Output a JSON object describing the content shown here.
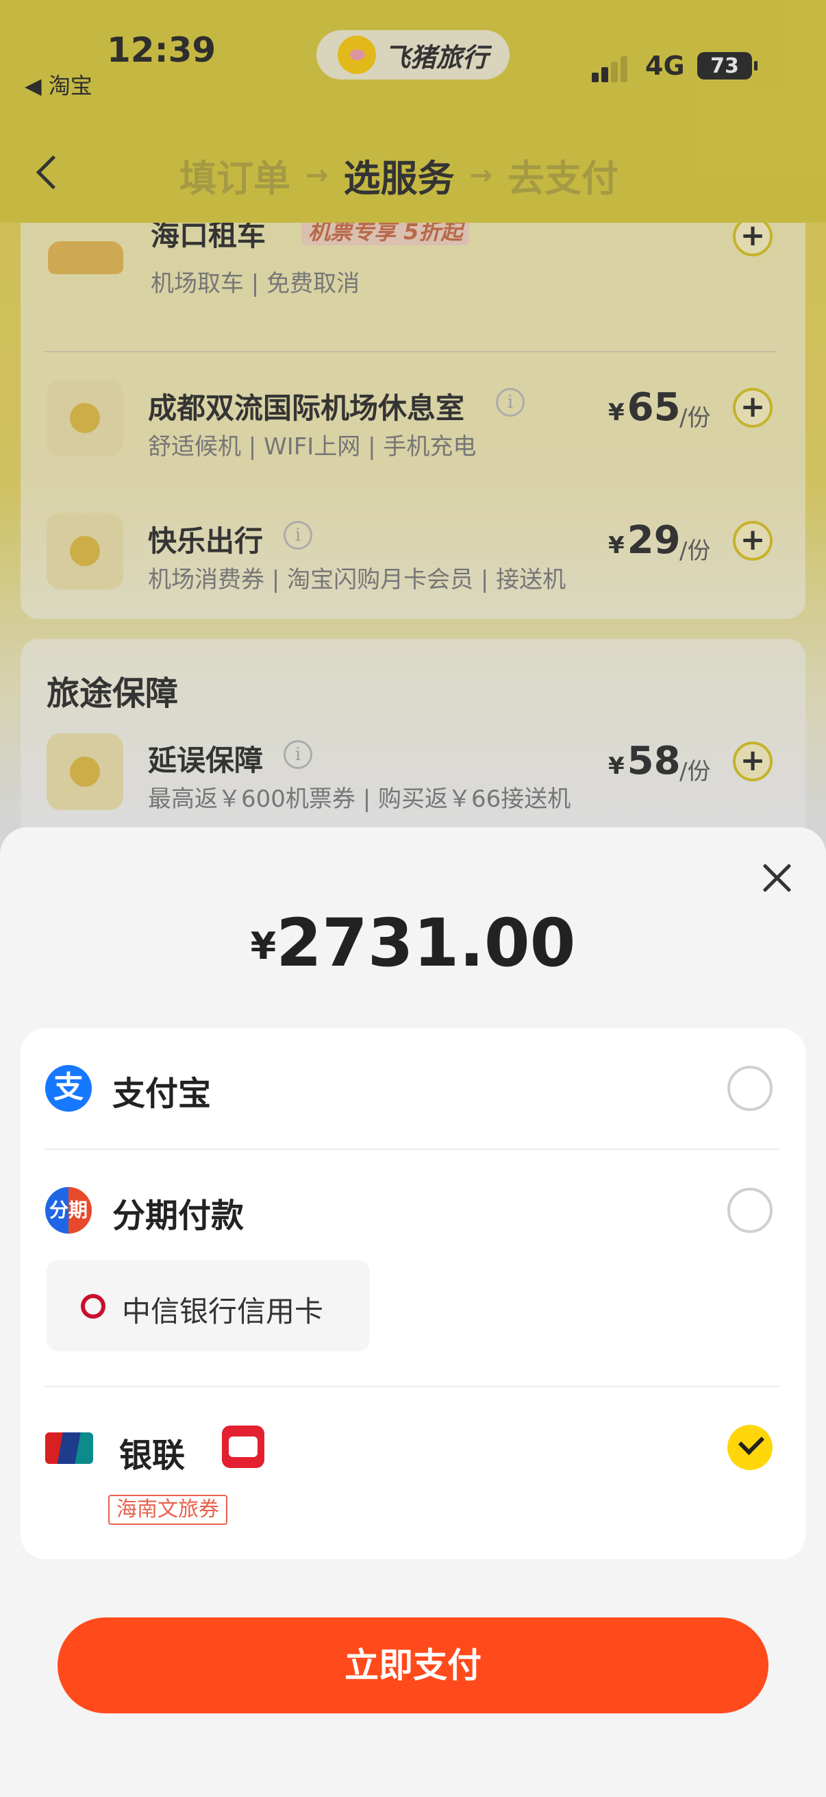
{
  "status_bar": {
    "time": "12:39",
    "back_app": "◀ 淘宝",
    "brand": "飞猪旅行",
    "network": "4G",
    "battery": "73"
  },
  "header": {
    "steps": [
      "填订单",
      "选服务",
      "去支付"
    ],
    "active_step": "选服务",
    "arrow": "→"
  },
  "services": {
    "car_rental": {
      "title": "海口租车",
      "tag": "机票专享 5折起",
      "sub": "机场取车 | 免费取消"
    },
    "lounge": {
      "title": "成都双流国际机场休息室",
      "sub": "舒适候机 | WIFI上网 | 手机充电",
      "price": "65",
      "currency": "¥",
      "unit": "/份"
    },
    "happy_travel": {
      "title": "快乐出行",
      "sub": "机场消费券 | 淘宝闪购月卡会员 | 接送机",
      "price": "29",
      "currency": "¥",
      "unit": "/份"
    }
  },
  "insurance": {
    "section_title": "旅途保障",
    "delay": {
      "title": "延误保障",
      "sub": "最高返￥600机票券 | 购买返￥66接送机",
      "price": "58",
      "currency": "¥",
      "unit": "/份"
    }
  },
  "payment_sheet": {
    "currency": "¥",
    "amount": "2731.00",
    "methods": {
      "alipay": "支付宝",
      "installment": "分期付款",
      "bank_card": "中信银行信用卡",
      "unionpay": "银联",
      "unionpay_tag": "海南文旅券"
    },
    "selected": "unionpay",
    "pay_button": "立即支付"
  },
  "colors": {
    "header_yellow": "#dccb34",
    "accent_yellow": "#ffd60a",
    "pay_button": "#ff4a1c",
    "alipay_blue": "#1677ff"
  }
}
